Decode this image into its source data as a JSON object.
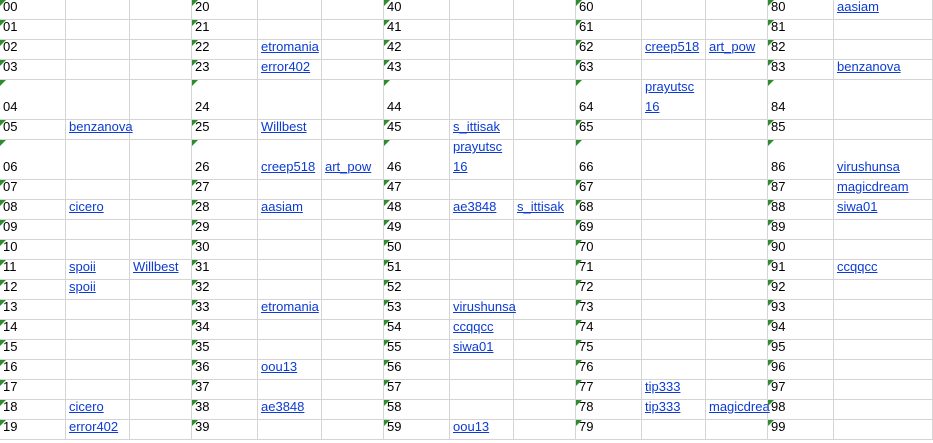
{
  "rows": [
    {
      "c": [
        "00",
        "",
        "",
        "20",
        "",
        "",
        "40",
        "",
        "",
        "60",
        "",
        "",
        "80",
        "aasiam"
      ]
    },
    {
      "c": [
        "01",
        "",
        "",
        "21",
        "",
        "",
        "41",
        "",
        "",
        "61",
        "",
        "",
        "81",
        ""
      ]
    },
    {
      "c": [
        "02",
        "",
        "",
        "22",
        "etromania",
        "",
        "42",
        "",
        "",
        "62",
        "creep518",
        "art_pow",
        "82",
        ""
      ]
    },
    {
      "c": [
        "03",
        "",
        "",
        "23",
        "error402",
        "",
        "43",
        "",
        "",
        "63",
        "",
        "",
        "83",
        "benzanova"
      ]
    },
    {
      "c": [
        "04",
        "",
        "",
        "24",
        "",
        "",
        "44",
        "",
        "",
        "64",
        "prayutsc 16",
        "",
        "84",
        ""
      ]
    },
    {
      "c": [
        "05",
        "benzanova",
        "",
        "25",
        "Willbest",
        "",
        "45",
        "s_ittisak",
        "",
        "65",
        "",
        "",
        "85",
        ""
      ]
    },
    {
      "c": [
        "06",
        "",
        "",
        "26",
        "creep518",
        "art_pow",
        "46",
        "prayutsc 16",
        "",
        "66",
        "",
        "",
        "86",
        "virushunsa"
      ]
    },
    {
      "c": [
        "07",
        "",
        "",
        "27",
        "",
        "",
        "47",
        "",
        "",
        "67",
        "",
        "",
        "87",
        "magicdream"
      ]
    },
    {
      "c": [
        "08",
        "cicero",
        "",
        "28",
        "aasiam",
        "",
        "48",
        "ae3848",
        "s_ittisak",
        "68",
        "",
        "",
        "88",
        "siwa01"
      ]
    },
    {
      "c": [
        "09",
        "",
        "",
        "29",
        "",
        "",
        "49",
        "",
        "",
        "69",
        "",
        "",
        "89",
        ""
      ]
    },
    {
      "c": [
        "10",
        "",
        "",
        "30",
        "",
        "",
        "50",
        "",
        "",
        "70",
        "",
        "",
        "90",
        ""
      ]
    },
    {
      "c": [
        "11",
        "spoii",
        "Willbest",
        "31",
        "",
        "",
        "51",
        "",
        "",
        "71",
        "",
        "",
        "91",
        "ccqqcc"
      ]
    },
    {
      "c": [
        "12",
        "spoii",
        "",
        "32",
        "",
        "",
        "52",
        "",
        "",
        "72",
        "",
        "",
        "92",
        ""
      ]
    },
    {
      "c": [
        "13",
        "",
        "",
        "33",
        "etromania",
        "",
        "53",
        "virushunsa",
        "",
        "73",
        "",
        "",
        "93",
        ""
      ]
    },
    {
      "c": [
        "14",
        "",
        "",
        "34",
        "",
        "",
        "54",
        "ccqqcc",
        "",
        "74",
        "",
        "",
        "94",
        ""
      ]
    },
    {
      "c": [
        "15",
        "",
        "",
        "35",
        "",
        "",
        "55",
        "siwa01",
        "",
        "75",
        "",
        "",
        "95",
        ""
      ]
    },
    {
      "c": [
        "16",
        "",
        "",
        "36",
        "oou13",
        "",
        "56",
        "",
        "",
        "76",
        "",
        "",
        "96",
        ""
      ]
    },
    {
      "c": [
        "17",
        "",
        "",
        "37",
        "",
        "",
        "57",
        "",
        "",
        "77",
        "tip333",
        "",
        "97",
        ""
      ]
    },
    {
      "c": [
        "18",
        "cicero",
        "",
        "38",
        "ae3848",
        "",
        "58",
        "",
        "",
        "78",
        "tip333",
        "magicdrea",
        "98",
        ""
      ]
    },
    {
      "c": [
        "19",
        "error402",
        "",
        "39",
        "",
        "",
        "59",
        "oou13",
        "",
        "79",
        "",
        "",
        "99",
        ""
      ]
    }
  ]
}
